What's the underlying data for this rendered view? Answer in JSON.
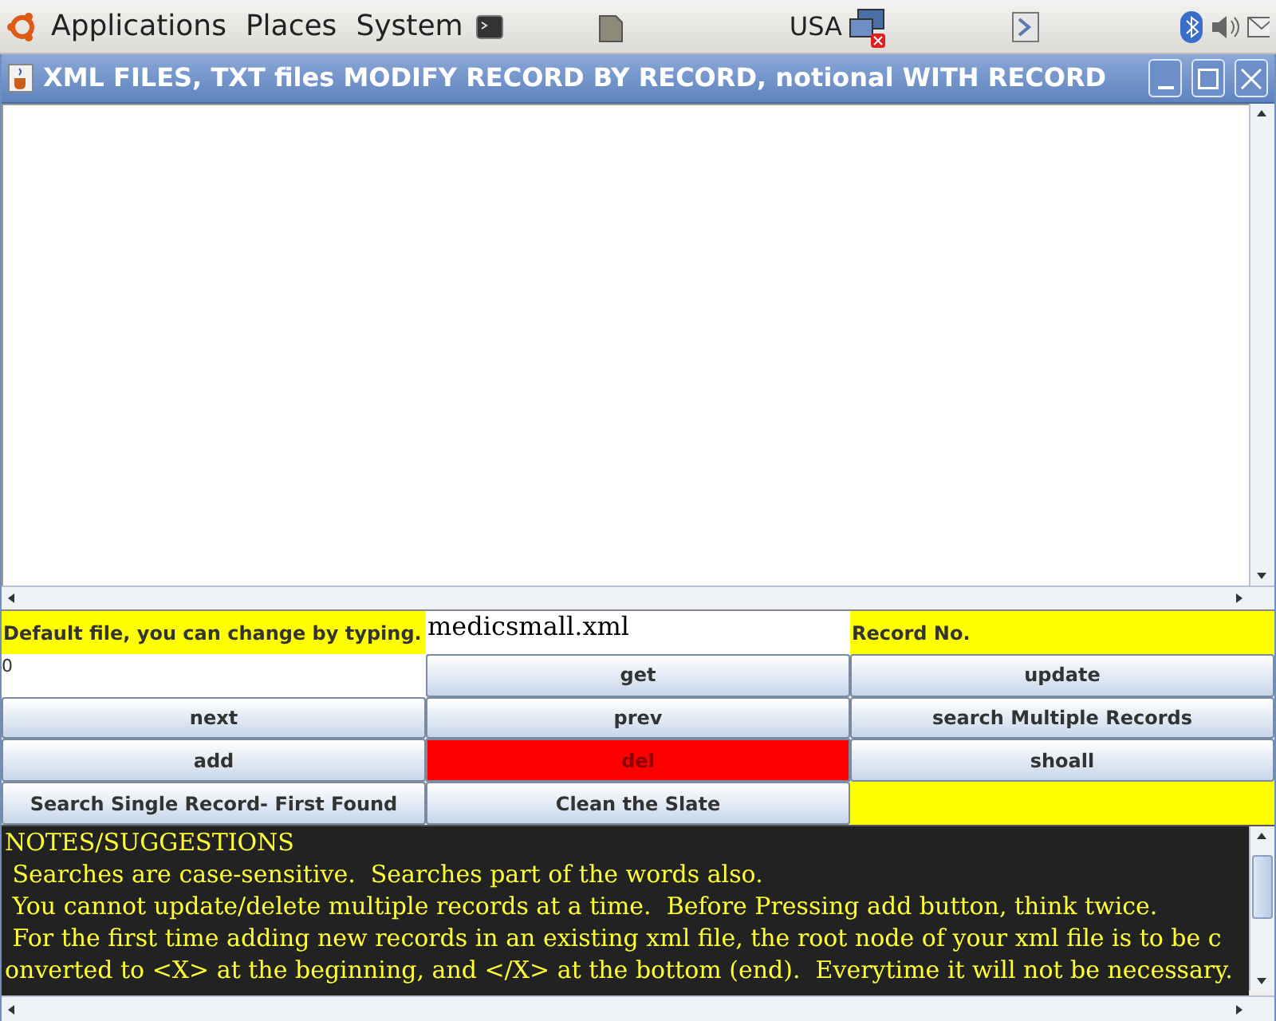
{
  "top_panel": {
    "menus": [
      "Applications",
      "Places",
      "System"
    ],
    "keyboard_layout": "USA"
  },
  "window": {
    "title": "XML FILES, TXT files MODIFY RECORD BY RECORD, notional WITH RECORD"
  },
  "form": {
    "cells": [
      {
        "kind": "label",
        "text": "Default file, you can change by typing."
      },
      {
        "kind": "field",
        "value": "medicsmall.xml"
      },
      {
        "kind": "label",
        "text": "Record No."
      },
      {
        "kind": "field",
        "value": "0"
      },
      {
        "kind": "button",
        "text": "get"
      },
      {
        "kind": "button",
        "text": "update"
      },
      {
        "kind": "button",
        "text": "next"
      },
      {
        "kind": "button",
        "text": "prev"
      },
      {
        "kind": "button",
        "text": "search Multiple Records"
      },
      {
        "kind": "button",
        "text": "add"
      },
      {
        "kind": "alert-button",
        "text": "del"
      },
      {
        "kind": "button",
        "text": "shoall"
      },
      {
        "kind": "button",
        "text": "Search Single Record- First Found"
      },
      {
        "kind": "button",
        "text": "Clean the Slate"
      },
      {
        "kind": "blank"
      }
    ]
  },
  "notes": {
    "lines": [
      "NOTES/SUGGESTIONS",
      " Searches are case-sensitive.  Searches part of the words also.",
      " You cannot update/delete multiple records at a time.  Before Pressing add button, think twice.",
      " For the first time adding new records in an existing xml file, the root node of your xml file is to be c",
      "onverted to <X> at the beginning, and </X> at the bottom (end).  Everytime it will not be necessary."
    ]
  }
}
